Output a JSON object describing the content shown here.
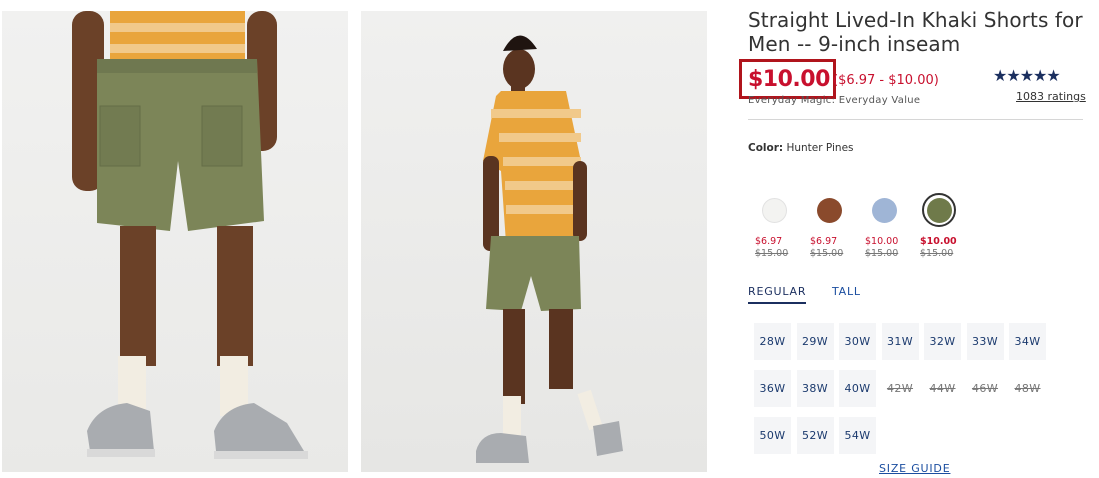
{
  "product": {
    "title": "Straight Lived-In Khaki Shorts for Men -- 9-inch inseam",
    "price": "$10.00",
    "price_range": "($6.97 - $10.00)",
    "price_tag": "Everyday Magic: Everyday Value",
    "rating_stars": "★★★★★",
    "rating_value": 4.5,
    "ratings_count": "1083 ratings"
  },
  "color": {
    "label": "Color:",
    "selected": "Hunter Pines",
    "swatches": [
      {
        "color": "#f3f3f1",
        "sale": "$6.97",
        "orig": "$15.00",
        "selected": false
      },
      {
        "color": "#8a4a2c",
        "sale": "$6.97",
        "orig": "$15.00",
        "selected": false
      },
      {
        "color": "#9fb5d6",
        "sale": "$10.00",
        "orig": "$15.00",
        "selected": false
      },
      {
        "color": "#6f7a4a",
        "sale": "$10.00",
        "orig": "$15.00",
        "selected": true
      }
    ]
  },
  "fit": {
    "tabs": [
      "REGULAR",
      "TALL"
    ],
    "active": "REGULAR"
  },
  "sizes": [
    {
      "label": "28W",
      "available": true
    },
    {
      "label": "29W",
      "available": true
    },
    {
      "label": "30W",
      "available": true
    },
    {
      "label": "31W",
      "available": true
    },
    {
      "label": "32W",
      "available": true
    },
    {
      "label": "33W",
      "available": true
    },
    {
      "label": "34W",
      "available": true
    },
    {
      "label": "36W",
      "available": true
    },
    {
      "label": "38W",
      "available": true
    },
    {
      "label": "40W",
      "available": true
    },
    {
      "label": "42W",
      "available": false
    },
    {
      "label": "44W",
      "available": false
    },
    {
      "label": "46W",
      "available": false
    },
    {
      "label": "48W",
      "available": false
    },
    {
      "label": "50W",
      "available": true
    },
    {
      "label": "52W",
      "available": true
    },
    {
      "label": "54W",
      "available": true
    }
  ],
  "size_guide": "SIZE GUIDE",
  "colors": {
    "accent_red": "#c8102e",
    "navy": "#1b2f5f",
    "link_blue": "#1b4ea0"
  }
}
